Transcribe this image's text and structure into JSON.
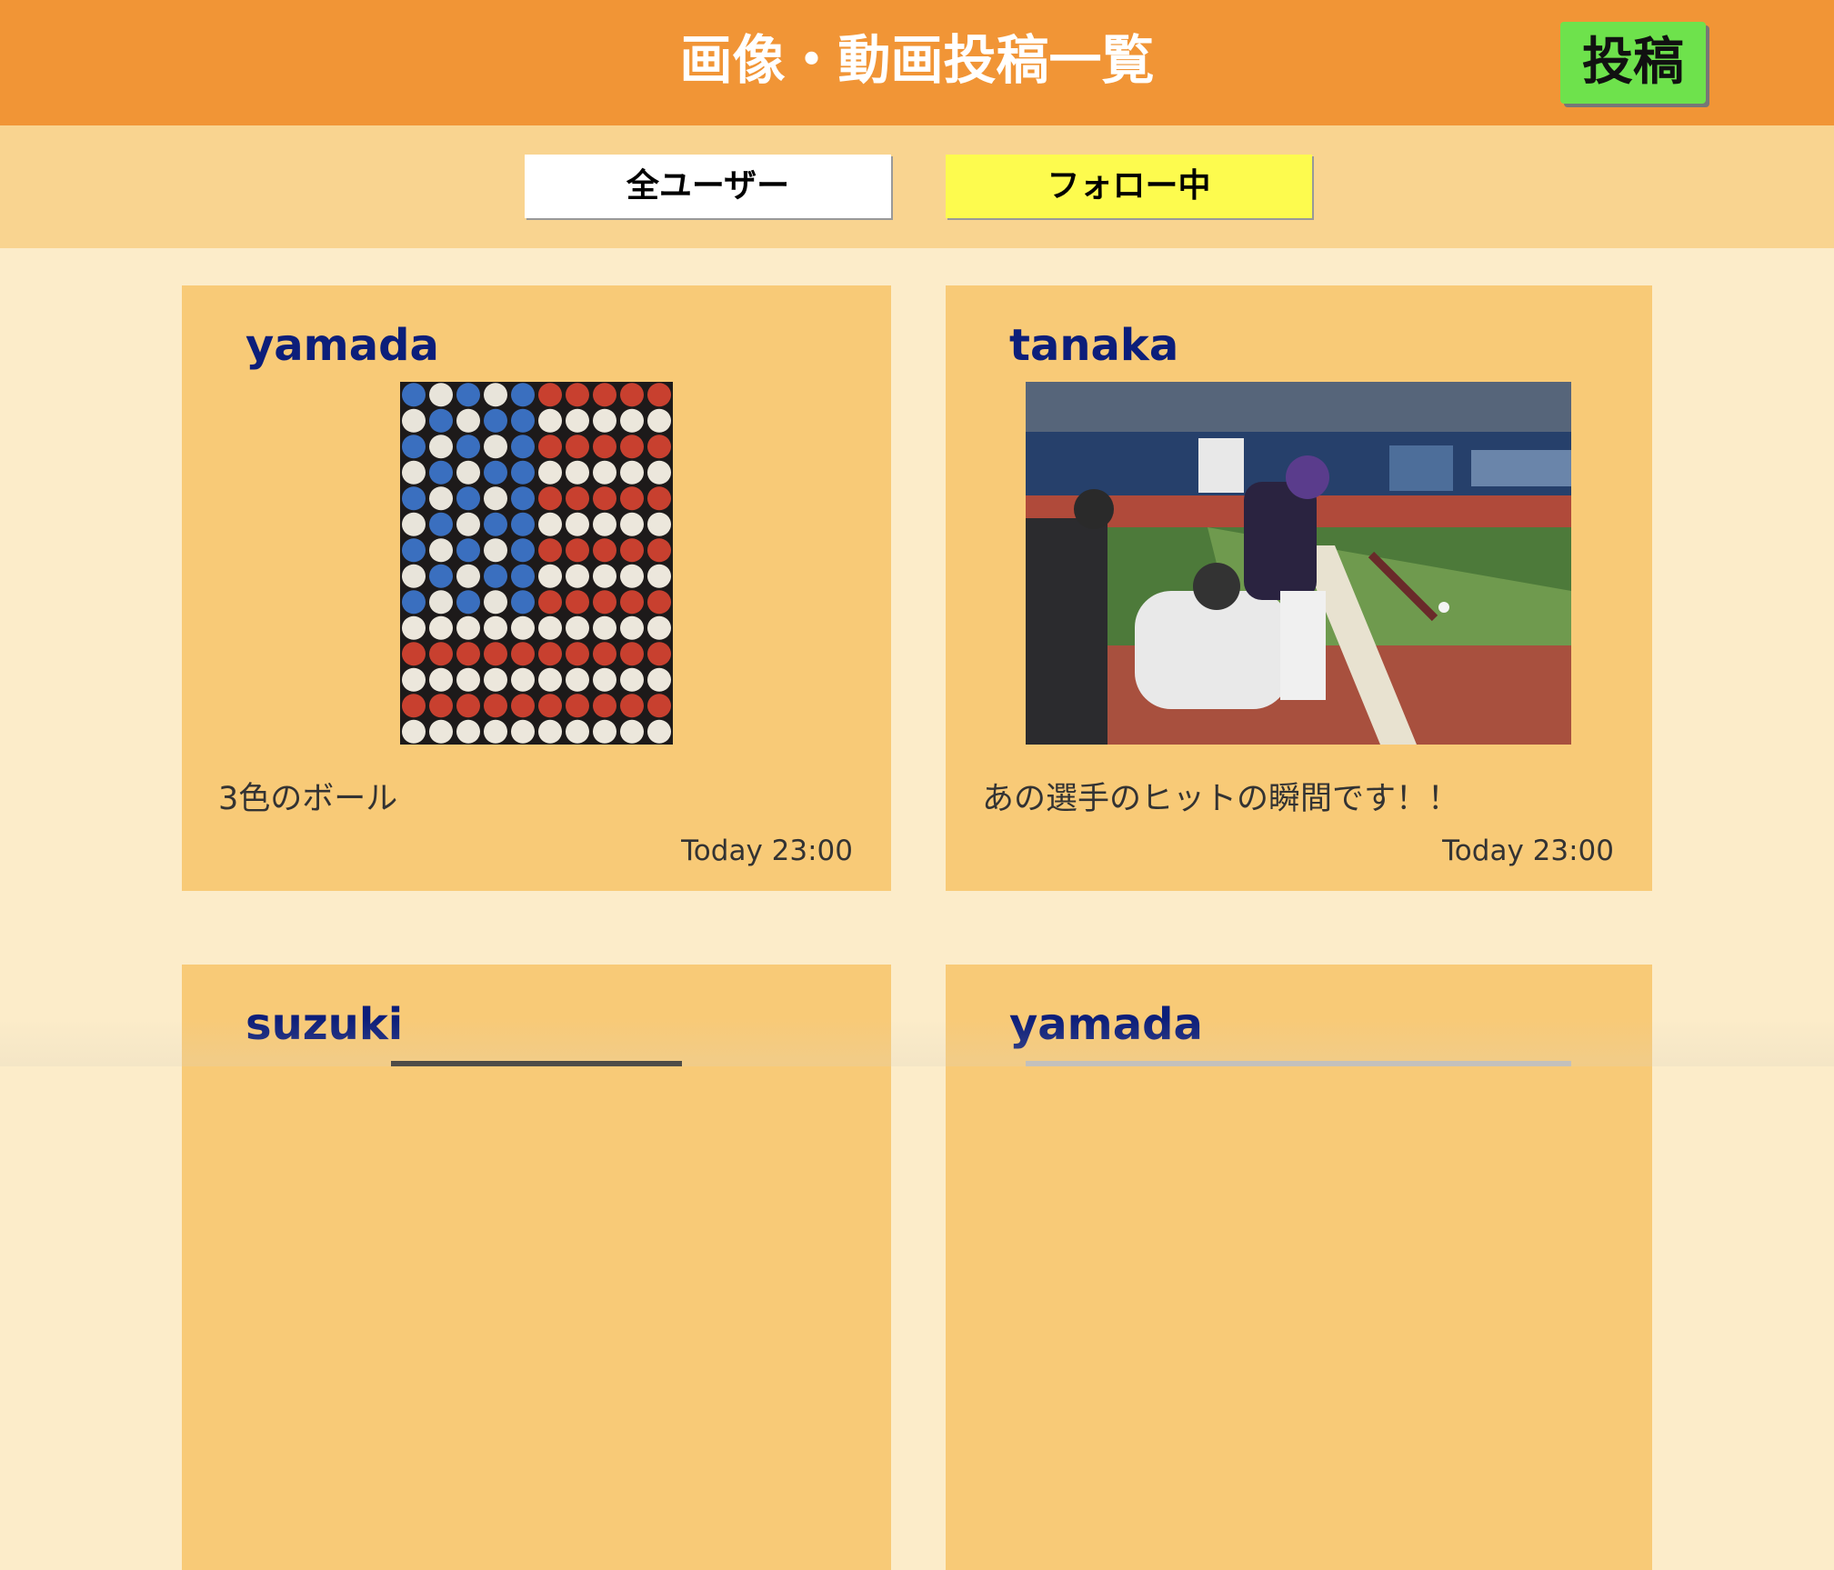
{
  "header": {
    "title": "画像・動画投稿一覧",
    "post_button_label": "投稿"
  },
  "tabs": [
    {
      "label": "全ユーザー"
    },
    {
      "label": "フォロー中"
    }
  ],
  "posts": [
    {
      "user": "yamada",
      "image": "baseballs-flag-photo",
      "caption": "3色のボール",
      "time": "Today 23:00"
    },
    {
      "user": "tanaka",
      "image": "batter-hitting-photo",
      "caption": "あの選手のヒットの瞬間です！！",
      "time": "Today 23:00"
    },
    {
      "user": "suzuki",
      "image": "dark-photo"
    },
    {
      "user": "yamada",
      "image": "light-photo"
    }
  ],
  "colors": {
    "header": "#f19536",
    "tab_bar": "#f9d490",
    "page_bg": "#fcecc9",
    "card_bg": "#f8ca77",
    "post_button": "#6ee24c",
    "tab_active": "#fdfb4e",
    "username": "#0c1e7a"
  }
}
